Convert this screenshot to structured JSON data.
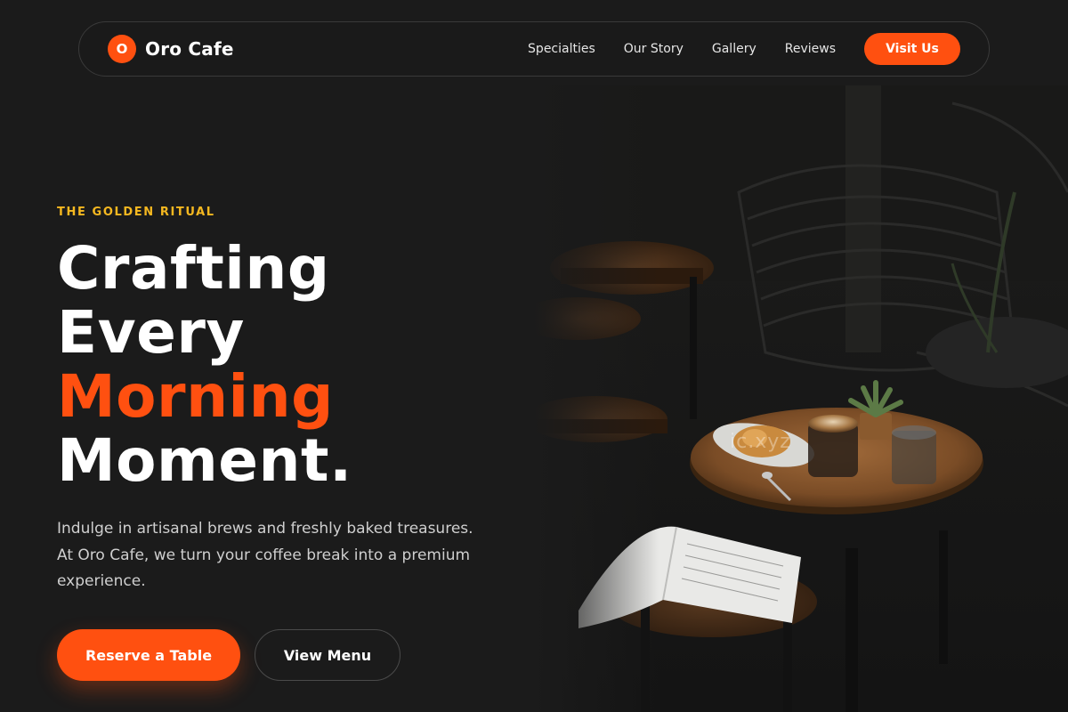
{
  "brand": {
    "logo_letter": "O",
    "name": "Oro Cafe"
  },
  "nav": {
    "links": [
      "Specialties",
      "Our Story",
      "Gallery",
      "Reviews"
    ],
    "cta": "Visit Us"
  },
  "hero": {
    "eyebrow": "THE GOLDEN RITUAL",
    "headline": [
      "Crafting",
      "Every",
      "Morning",
      "Moment."
    ],
    "accent_word": "Morning",
    "lead": "Indulge in artisanal brews and freshly baked treasures. At Oro Cafe, we turn your coffee break into a premium experience.",
    "primary_button": "Reserve a Table",
    "secondary_button": "View Menu",
    "image_watermark": "ic.xyz"
  },
  "colors": {
    "background": "#1b1b1b",
    "accent": "#ff5010",
    "eyebrow": "#f5b820",
    "text": "#ffffff",
    "muted_text": "#cfcfcf"
  }
}
